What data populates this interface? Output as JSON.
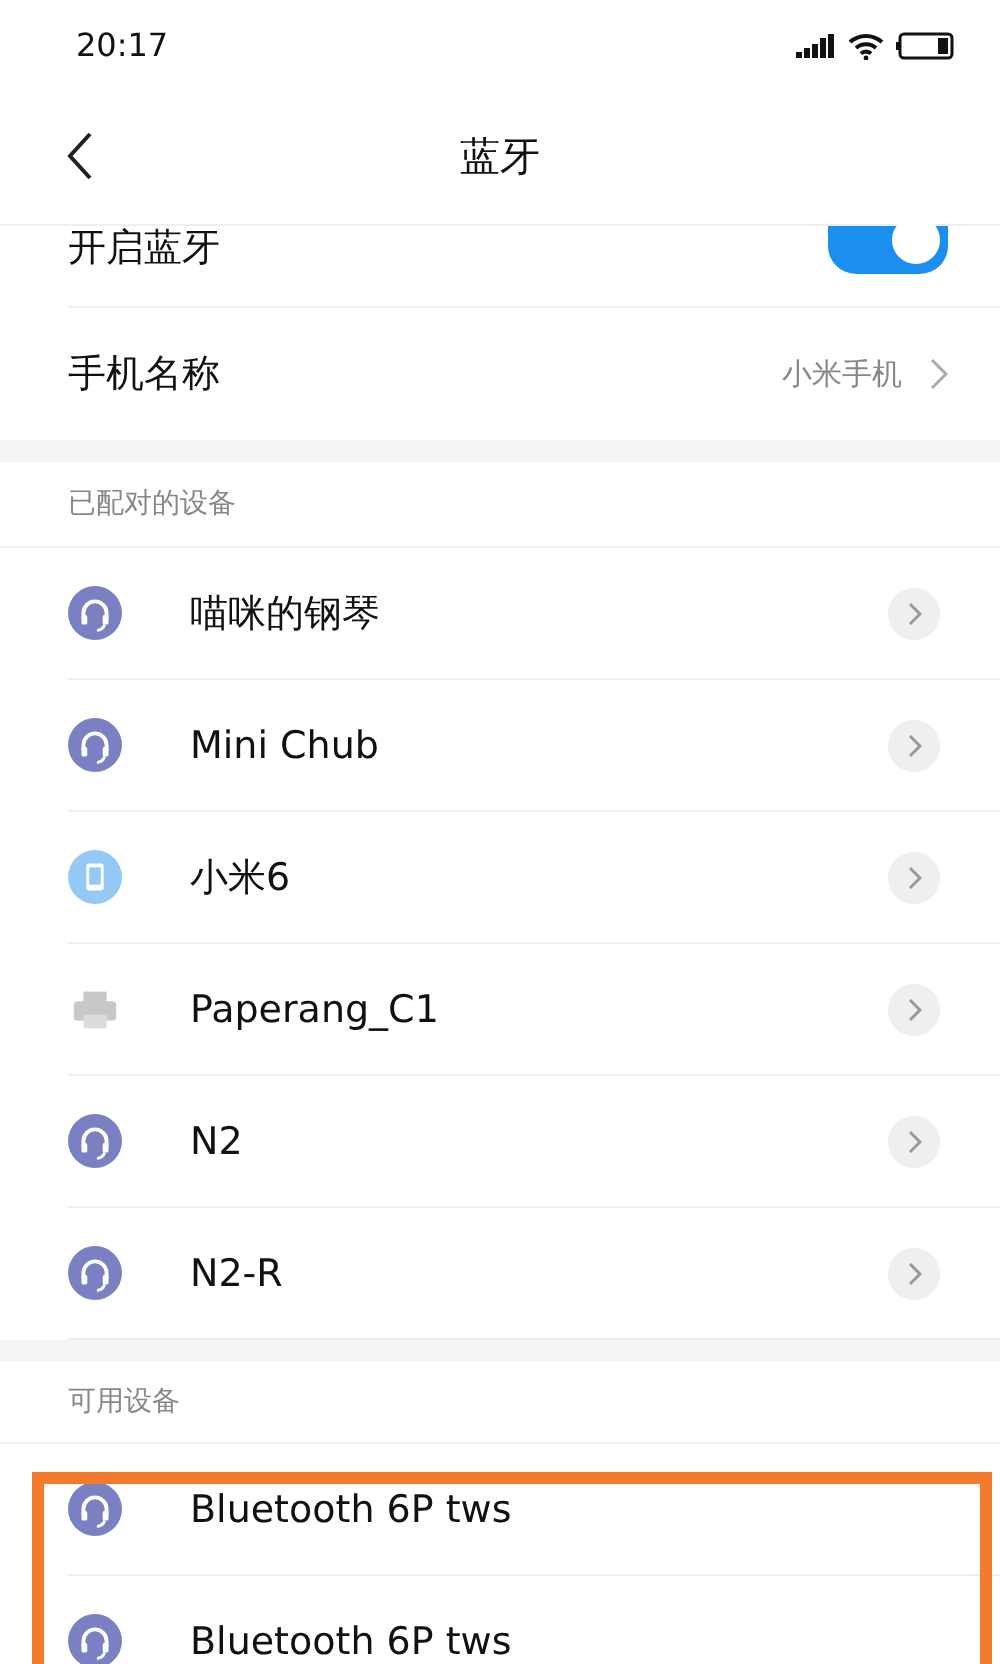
{
  "status_bar": {
    "time": "20:17"
  },
  "header": {
    "title": "蓝牙"
  },
  "bluetooth_toggle": {
    "label": "开启蓝牙",
    "on": true
  },
  "phone_name": {
    "label": "手机名称",
    "value": "小米手机"
  },
  "paired_devices": {
    "title": "已配对的设备",
    "items": [
      {
        "name": "喵咪的钢琴",
        "kind": "headset"
      },
      {
        "name": "Mini Chub",
        "kind": "headset"
      },
      {
        "name": "小米6",
        "kind": "phone"
      },
      {
        "name": "Paperang_C1",
        "kind": "printer"
      },
      {
        "name": "N2",
        "kind": "headset"
      },
      {
        "name": "N2-R",
        "kind": "headset"
      }
    ]
  },
  "available_devices": {
    "title": "可用设备",
    "highlighted": true,
    "items": [
      {
        "name": "Bluetooth 6P tws",
        "kind": "headset"
      },
      {
        "name": "Bluetooth 6P tws",
        "kind": "headset"
      }
    ]
  }
}
